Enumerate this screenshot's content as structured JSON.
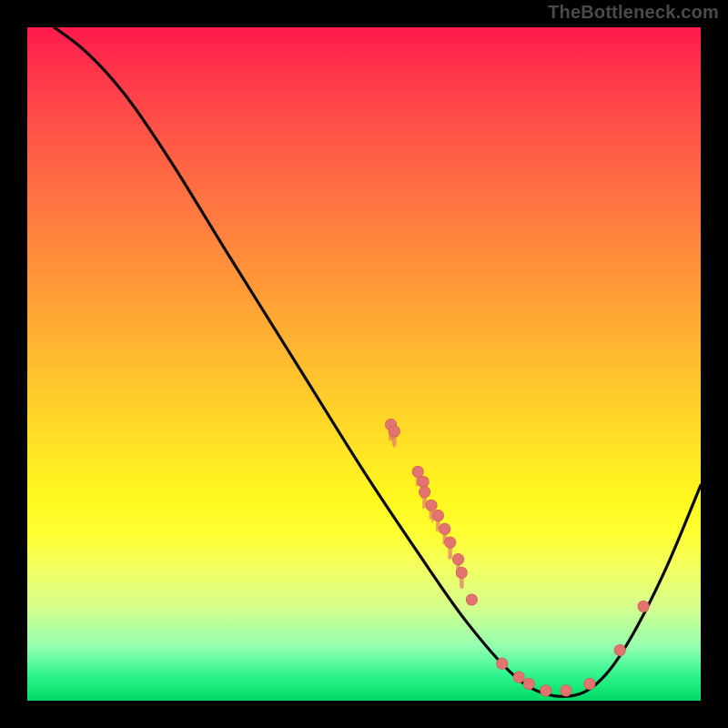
{
  "watermark": "TheBottleneck.com",
  "colors": {
    "dot": "#e2736e",
    "curve": "#0a0a0a"
  },
  "chart_data": {
    "type": "line",
    "title": "",
    "xlabel": "",
    "ylabel": "",
    "xlim": [
      0,
      100
    ],
    "ylim": [
      0,
      100
    ],
    "curve": [
      {
        "x": 4,
        "y": 100
      },
      {
        "x": 8,
        "y": 97
      },
      {
        "x": 12,
        "y": 93
      },
      {
        "x": 16,
        "y": 88
      },
      {
        "x": 22,
        "y": 79
      },
      {
        "x": 30,
        "y": 66
      },
      {
        "x": 40,
        "y": 50
      },
      {
        "x": 50,
        "y": 34
      },
      {
        "x": 58,
        "y": 22
      },
      {
        "x": 65,
        "y": 12
      },
      {
        "x": 72,
        "y": 4
      },
      {
        "x": 77,
        "y": 1
      },
      {
        "x": 82,
        "y": 1
      },
      {
        "x": 86,
        "y": 4
      },
      {
        "x": 90,
        "y": 10
      },
      {
        "x": 95,
        "y": 20
      },
      {
        "x": 100,
        "y": 32
      }
    ],
    "points": [
      {
        "x": 54,
        "y": 41,
        "smear": true
      },
      {
        "x": 54.5,
        "y": 40,
        "smear": true
      },
      {
        "x": 58,
        "y": 34,
        "smear": true
      },
      {
        "x": 58.8,
        "y": 32.5,
        "smear": true
      },
      {
        "x": 59,
        "y": 31,
        "smear": true
      },
      {
        "x": 60,
        "y": 29,
        "smear": true
      },
      {
        "x": 61,
        "y": 27.5,
        "smear": true
      },
      {
        "x": 62,
        "y": 25.5,
        "smear": true
      },
      {
        "x": 62.8,
        "y": 23.5,
        "smear": true
      },
      {
        "x": 64,
        "y": 21,
        "smear": true
      },
      {
        "x": 64.5,
        "y": 19,
        "smear": true
      },
      {
        "x": 66,
        "y": 15,
        "smear": false
      },
      {
        "x": 70.5,
        "y": 5.5,
        "smear": false
      },
      {
        "x": 73,
        "y": 3.5,
        "smear": false
      },
      {
        "x": 74.5,
        "y": 2.5,
        "smear": false
      },
      {
        "x": 77,
        "y": 1.5,
        "smear": false
      },
      {
        "x": 80,
        "y": 1.5,
        "smear": false
      },
      {
        "x": 83.5,
        "y": 2.5,
        "smear": false
      },
      {
        "x": 88,
        "y": 7.5,
        "smear": false
      },
      {
        "x": 91.5,
        "y": 14,
        "smear": false
      }
    ]
  }
}
